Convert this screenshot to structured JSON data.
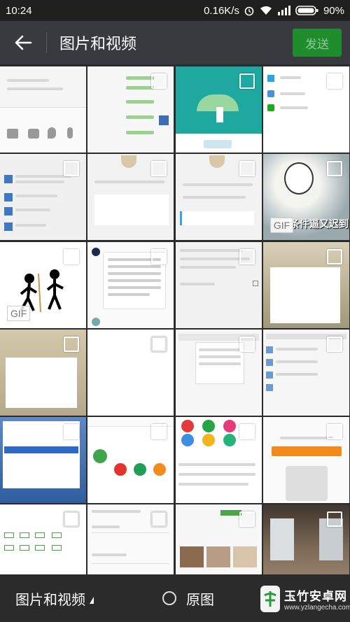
{
  "status_bar": {
    "time": "10:24",
    "speed": "0.16K/s",
    "battery": "90%"
  },
  "header": {
    "title": "图片和视频",
    "send_label": "发送"
  },
  "grid": {
    "gif_label": "GIF",
    "cells": [
      {
        "kind": "chat-toolbar"
      },
      {
        "kind": "green-list"
      },
      {
        "kind": "teal-illustration"
      },
      {
        "kind": "wechat-search"
      },
      {
        "kind": "chat-list"
      },
      {
        "kind": "chat-screen-a"
      },
      {
        "kind": "chat-screen-b"
      },
      {
        "kind": "meme-dog",
        "gif": true,
        "caption": "条件逼又迟到"
      },
      {
        "kind": "stick-figures",
        "gif": true
      },
      {
        "kind": "notice-text"
      },
      {
        "kind": "settings"
      },
      {
        "kind": "room-photo"
      },
      {
        "kind": "blank-photo"
      },
      {
        "kind": "blank"
      },
      {
        "kind": "doc-screen"
      },
      {
        "kind": "file-list"
      },
      {
        "kind": "desktop"
      },
      {
        "kind": "app-store"
      },
      {
        "kind": "color-icons"
      },
      {
        "kind": "download-ad"
      },
      {
        "kind": "keyboard-tags"
      },
      {
        "kind": "form"
      },
      {
        "kind": "furniture"
      },
      {
        "kind": "interior-photo"
      }
    ]
  },
  "bottom_bar": {
    "album_label": "图片和视频",
    "original_label": "原图"
  },
  "watermark": {
    "main": "玉竹安卓网",
    "sub": "www.yzlangecha.com"
  },
  "colors": {
    "app_bar": "#393a3f",
    "send_button": "#1f8c2d",
    "background": "#2b2b2b"
  }
}
